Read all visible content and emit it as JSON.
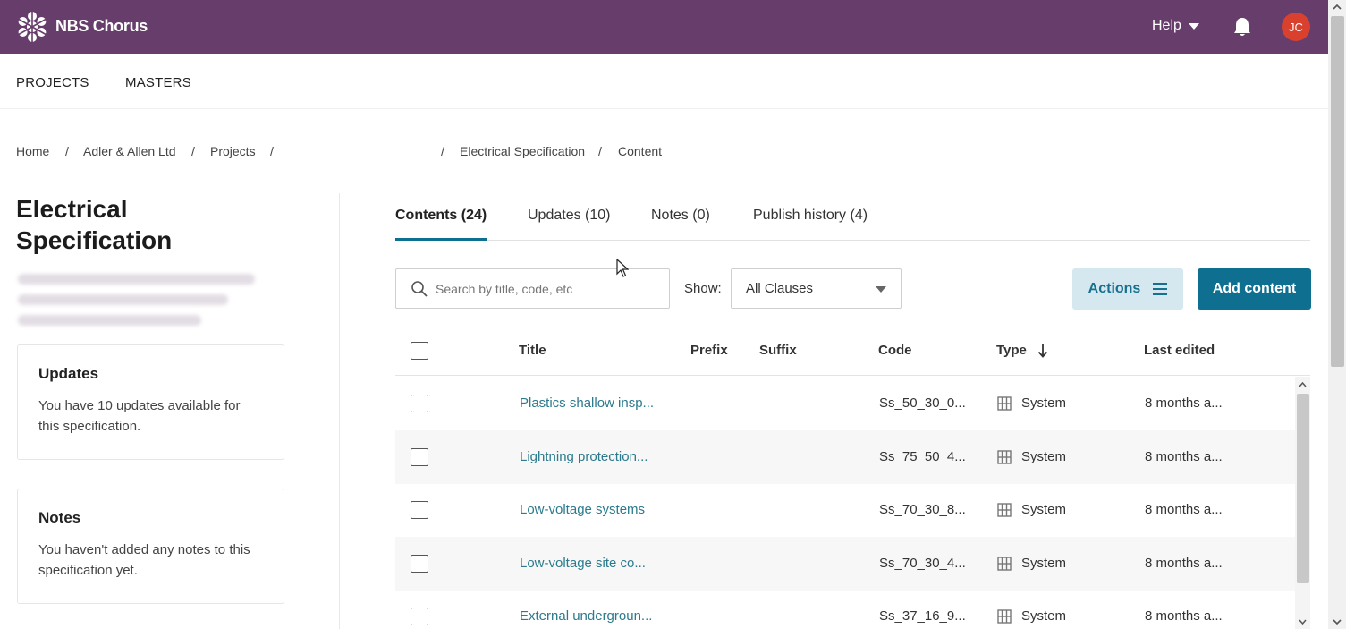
{
  "brand": {
    "name": "NBS Chorus"
  },
  "header": {
    "help_label": "Help",
    "avatar_initials": "JC",
    "accent_color": "#673e6b"
  },
  "nav": {
    "projects": "PROJECTS",
    "masters": "MASTERS"
  },
  "breadcrumb": {
    "home": "Home",
    "client": "Adler & Allen Ltd",
    "projects": "Projects",
    "spec": "Electrical Specification",
    "current": "Content",
    "sep": "/"
  },
  "sidebar": {
    "title": "Electrical Specification",
    "updates_card": {
      "heading": "Updates",
      "text": "You have 10 updates available for this specification."
    },
    "notes_card": {
      "heading": "Notes",
      "text": "You haven't added any notes to this specification yet."
    }
  },
  "tabs": [
    {
      "label": "Contents (24)",
      "active": true
    },
    {
      "label": "Updates (10)",
      "active": false
    },
    {
      "label": "Notes (0)",
      "active": false
    },
    {
      "label": "Publish history (4)",
      "active": false
    }
  ],
  "toolbar": {
    "search_placeholder": "Search by title, code, etc",
    "show_label": "Show:",
    "show_value": "All Clauses",
    "actions_label": "Actions",
    "add_label": "Add content",
    "primary_color": "#0e6f91"
  },
  "table": {
    "headers": {
      "title": "Title",
      "prefix": "Prefix",
      "suffix": "Suffix",
      "code": "Code",
      "type": "Type",
      "last_edited": "Last edited"
    },
    "sort": "Type descending",
    "rows": [
      {
        "title": "Plastics shallow insp...",
        "code": "Ss_50_30_0...",
        "type": "System",
        "last_edited": "8 months a..."
      },
      {
        "title": "Lightning protection...",
        "code": "Ss_75_50_4...",
        "type": "System",
        "last_edited": "8 months a..."
      },
      {
        "title": "Low-voltage systems",
        "code": "Ss_70_30_8...",
        "type": "System",
        "last_edited": "8 months a..."
      },
      {
        "title": "Low-voltage site co...",
        "code": "Ss_70_30_4...",
        "type": "System",
        "last_edited": "8 months a..."
      },
      {
        "title": "External undergroun...",
        "code": "Ss_37_16_9...",
        "type": "System",
        "last_edited": "8 months a..."
      }
    ]
  }
}
